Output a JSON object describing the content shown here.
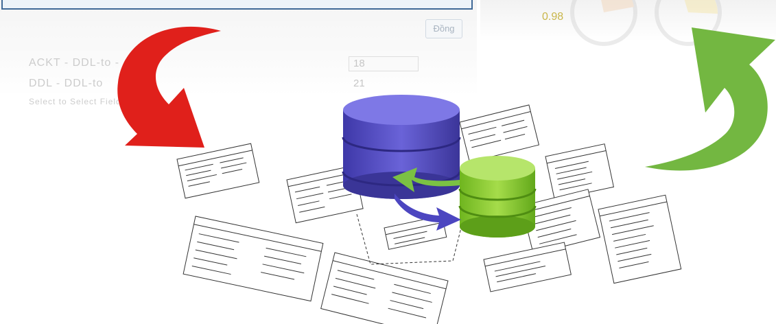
{
  "faded_form": {
    "button_label": "Đồng",
    "row1_label": "ACKT - DDL-to -",
    "row1_value": "18",
    "row2_label": "DDL - DDL-to",
    "row2_value": "21",
    "row3_label": "Select to Select Field Vis"
  },
  "faded_dashboard": {
    "value_text": "0.98"
  },
  "colors": {
    "red_arrow": "#e0201b",
    "green_arrow": "#73b741",
    "big_db": "#5a54c8",
    "small_db": "#8fcf3c",
    "panel_border": "#1f4f86"
  }
}
